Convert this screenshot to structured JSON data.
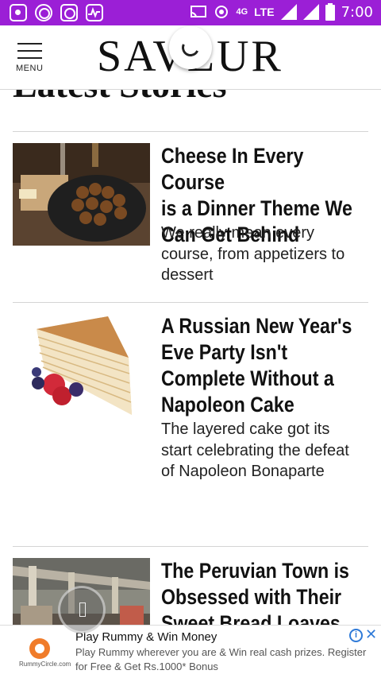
{
  "status_bar": {
    "network": "4G",
    "lte": "LTE",
    "time": "7:00"
  },
  "header": {
    "menu_label": "MENU",
    "logo": "SAVEUR"
  },
  "section_title": "Latest Stories",
  "stories": [
    {
      "title_lines": [
        "Cheese In Every Course",
        "is a Dinner Theme We",
        "Can Get Behind"
      ],
      "dek_lines": [
        "We really mean every",
        "course, from appetizers to",
        "dessert"
      ]
    },
    {
      "title_lines": [
        "A Russian New Year's",
        "Eve Party Isn't",
        "Complete Without a",
        "Napoleon Cake"
      ],
      "dek_lines": [
        "The layered cake got its",
        "start celebrating the defeat",
        "of Napoleon Bonaparte"
      ]
    },
    {
      "title_lines": [
        "The Peruvian Town is",
        "Obsessed with Their",
        "Sweet Bread Loaves"
      ],
      "dek_lines": []
    }
  ],
  "ad": {
    "title": "Play Rummy & Win Money",
    "text": "Play Rummy wherever you are & Win real cash prizes. Register for Free & Get Rs.1000* Bonus",
    "logo_text": "RummyCircle.com",
    "info_icon": "i",
    "close_icon": "✕"
  }
}
